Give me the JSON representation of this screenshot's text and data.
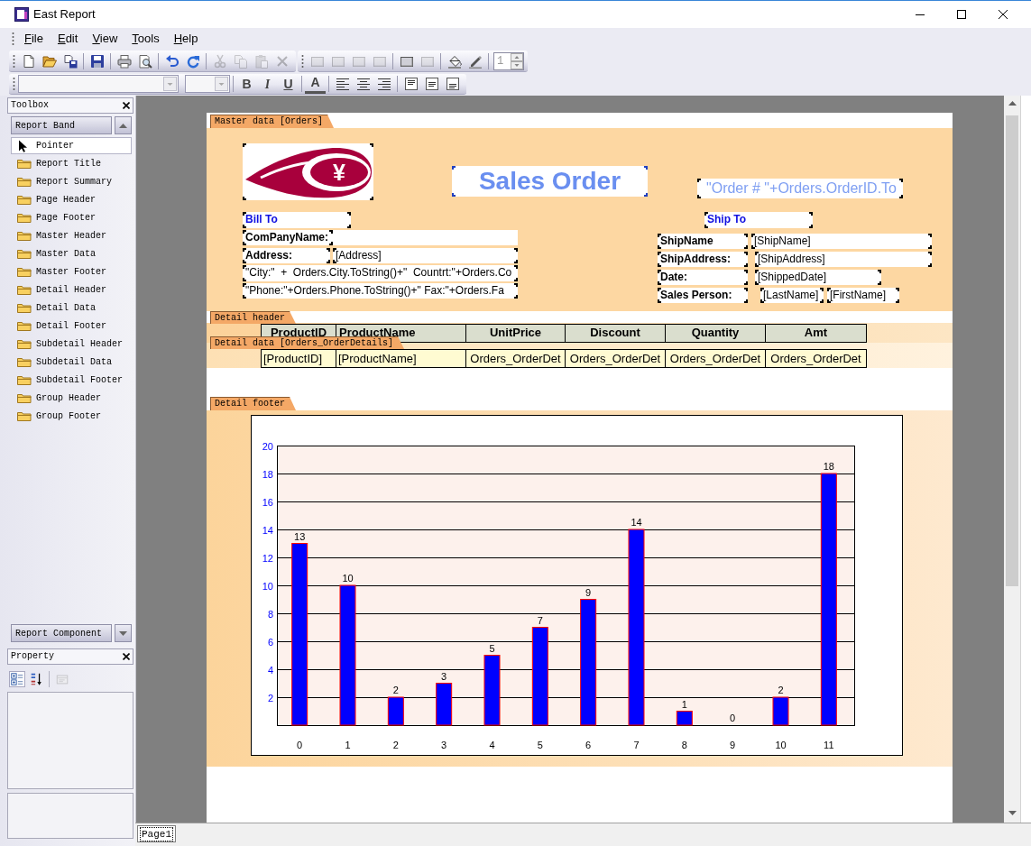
{
  "window": {
    "title": "East Report"
  },
  "menu": [
    {
      "label": "File"
    },
    {
      "label": "Edit"
    },
    {
      "label": "View"
    },
    {
      "label": "Tools"
    },
    {
      "label": "Help"
    }
  ],
  "toolbars": [
    {
      "groups": [
        [
          {
            "kind": "new",
            "disabled": false
          },
          {
            "kind": "open",
            "disabled": false
          },
          {
            "kind": "save_as",
            "disabled": false
          }
        ],
        [
          {
            "kind": "save",
            "disabled": false
          }
        ],
        [
          {
            "kind": "print",
            "disabled": false
          },
          {
            "kind": "preview",
            "disabled": false
          }
        ],
        [
          {
            "kind": "undo",
            "disabled": false
          },
          {
            "kind": "redo",
            "disabled": false
          }
        ],
        [
          {
            "kind": "cut",
            "disabled": true
          },
          {
            "kind": "copy",
            "disabled": true
          },
          {
            "kind": "paste",
            "disabled": true
          },
          {
            "kind": "delete",
            "disabled": true
          }
        ]
      ]
    },
    {
      "groups": [
        [
          {
            "kind": "frame",
            "disabled": true
          },
          {
            "kind": "frame",
            "disabled": true
          },
          {
            "kind": "frame",
            "disabled": true
          },
          {
            "kind": "frame",
            "disabled": true
          }
        ],
        [
          {
            "kind": "frame",
            "disabled": false
          },
          {
            "kind": "frame",
            "disabled": true
          }
        ],
        [
          {
            "kind": "fill",
            "disabled": false
          },
          {
            "kind": "pen",
            "disabled": false
          }
        ],
        [
          {
            "kind": "spinner",
            "value": "1",
            "disabled": true
          }
        ]
      ]
    },
    {
      "groups": [
        [
          {
            "kind": "font_combo",
            "disabled": true
          },
          {
            "kind": "size_combo",
            "disabled": true
          }
        ],
        [
          {
            "kind": "bold",
            "label": "B",
            "disabled": false
          },
          {
            "kind": "italic",
            "label": "I",
            "disabled": false
          },
          {
            "kind": "underline",
            "label": "U",
            "disabled": false
          }
        ],
        [
          {
            "kind": "font_color",
            "label": "A",
            "disabled": false
          }
        ],
        [
          {
            "kind": "align_left",
            "disabled": false
          },
          {
            "kind": "align_center",
            "disabled": false
          },
          {
            "kind": "align_right",
            "disabled": false
          }
        ],
        [
          {
            "kind": "para_top",
            "disabled": false
          },
          {
            "kind": "para_middle",
            "disabled": false
          },
          {
            "kind": "para_bottom",
            "disabled": false
          }
        ]
      ]
    }
  ],
  "toolbox": {
    "title": "Toolbox",
    "group": "Report Band",
    "items": [
      {
        "label": "Pointer",
        "kind": "pointer",
        "selected": true
      },
      {
        "label": "Report Title",
        "kind": "band",
        "selected": false
      },
      {
        "label": "Report Summary",
        "kind": "band",
        "selected": false
      },
      {
        "label": "Page Header",
        "kind": "band",
        "selected": false
      },
      {
        "label": "Page Footer",
        "kind": "band",
        "selected": false
      },
      {
        "label": "Master Header",
        "kind": "band",
        "selected": false
      },
      {
        "label": "Master Data",
        "kind": "band",
        "selected": false
      },
      {
        "label": "Master Footer",
        "kind": "band",
        "selected": false
      },
      {
        "label": "Detail Header",
        "kind": "band",
        "selected": false
      },
      {
        "label": "Detail Data",
        "kind": "band",
        "selected": false
      },
      {
        "label": "Detail Footer",
        "kind": "band",
        "selected": false
      },
      {
        "label": "Subdetail Header",
        "kind": "band",
        "selected": false
      },
      {
        "label": "Subdetail Data",
        "kind": "band",
        "selected": false
      },
      {
        "label": "Subdetail Footer",
        "kind": "band",
        "selected": false
      },
      {
        "label": "Group Header",
        "kind": "band",
        "selected": false
      },
      {
        "label": "Group Footer",
        "kind": "band",
        "selected": false
      }
    ]
  },
  "components": {
    "group": "Report Component"
  },
  "property": {
    "title": "Property",
    "tools": [
      {
        "kind": "categorized",
        "selected": true,
        "disabled": false
      },
      {
        "kind": "alphabetical",
        "selected": false,
        "disabled": false
      },
      {
        "kind": "pages",
        "selected": false,
        "disabled": true
      }
    ]
  },
  "report": {
    "master": {
      "band_label": "Master data [Orders]",
      "logo_symbol": "¥",
      "title": "Sales Order",
      "order_number": "\"Order # \"+Orders.OrderID.To",
      "fields": [
        {
          "text": "Bill To",
          "kind": "heading"
        },
        {
          "text": "Ship To",
          "kind": "heading"
        },
        {
          "text": "ComPanyName:",
          "kind": "caption"
        },
        {
          "text": "ShipName",
          "kind": "caption"
        },
        {
          "text": "[ShipName]",
          "kind": "value"
        },
        {
          "text": "Address:",
          "kind": "caption"
        },
        {
          "text": "[Address]",
          "kind": "value"
        },
        {
          "text": "ShipAddress:",
          "kind": "caption"
        },
        {
          "text": "[ShipAddress]",
          "kind": "value"
        },
        {
          "text": "\"City:\"  +  Orders.City.ToString()+\"  Countrt:\"+Orders.Co",
          "kind": "value"
        },
        {
          "text": "Date:",
          "kind": "caption"
        },
        {
          "text": "[ShippedDate]",
          "kind": "value"
        },
        {
          "text": "\"Phone:\"+Orders.Phone.ToString()+\" Fax:\"+Orders.Fa",
          "kind": "value"
        },
        {
          "text": "Sales Person:",
          "kind": "caption"
        },
        {
          "text": "[LastName]",
          "kind": "value"
        },
        {
          "text": "[FirstName]",
          "kind": "value"
        }
      ]
    },
    "detail_header": {
      "band_label": "Detail header",
      "columns": [
        "ProductID",
        "ProductName",
        "UnitPrice",
        "Discount",
        "Quantity",
        "Amt"
      ]
    },
    "detail_data": {
      "band_label": "Detail data [Orders_OrderDetails]",
      "cells": [
        "[ProductID]",
        "[ProductName]",
        "Orders_OrderDet",
        "Orders_OrderDet",
        "Orders_OrderDet",
        "Orders_OrderDet"
      ]
    },
    "detail_footer": {
      "band_label": "Detail footer",
      "chart_data": {
        "type": "bar",
        "categories": [
          "0",
          "1",
          "2",
          "3",
          "4",
          "5",
          "6",
          "7",
          "8",
          "9",
          "10",
          "11"
        ],
        "series": [
          {
            "color": "#0000ff",
            "values": [
              13,
              10,
              2,
              3,
              5,
              7,
              9,
              14,
              1,
              0,
              2,
              18
            ]
          }
        ],
        "ylim": [
          0,
          20
        ],
        "yticks": [
          2,
          4,
          6,
          8,
          10,
          12,
          14,
          16,
          18,
          20
        ],
        "grid": true,
        "data_labels": true
      }
    }
  },
  "page_tabs": [
    {
      "label": "Page1",
      "selected": true
    }
  ]
}
